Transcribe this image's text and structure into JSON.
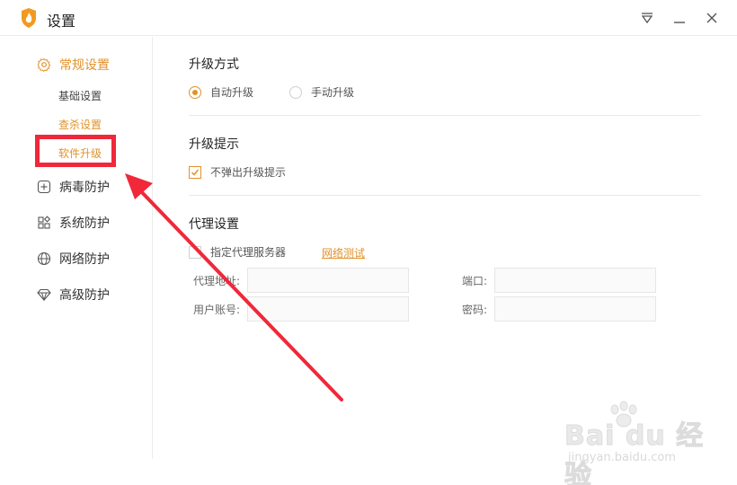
{
  "window": {
    "title": "设置",
    "controls": [
      "dropdown-icon",
      "minimize-icon",
      "close-icon"
    ]
  },
  "sidebar": {
    "groups": [
      {
        "label": "常规设置",
        "icon": "gear-icon",
        "active": true
      },
      {
        "label": "病毒防护",
        "icon": "plus-box-icon"
      },
      {
        "label": "系统防护",
        "icon": "grid-icon"
      },
      {
        "label": "网络防护",
        "icon": "globe-icon"
      },
      {
        "label": "高级防护",
        "icon": "diamond-icon"
      }
    ],
    "subitems": [
      {
        "label": "基础设置"
      },
      {
        "label": "查杀设置"
      },
      {
        "label": "软件升级",
        "active": true
      }
    ]
  },
  "main": {
    "upgrade_mode": {
      "title": "升级方式",
      "options": [
        {
          "label": "自动升级",
          "checked": true
        },
        {
          "label": "手动升级",
          "checked": false
        }
      ]
    },
    "upgrade_tip": {
      "title": "升级提示",
      "checkbox_label": "不弹出升级提示",
      "checked": true
    },
    "proxy": {
      "title": "代理设置",
      "checkbox_label": "指定代理服务器",
      "checked": false,
      "test_link": "网络测试",
      "address_label": "代理地址:",
      "address_value": "",
      "port_label": "端口:",
      "port_value": "",
      "account_label": "用户账号:",
      "account_value": "",
      "password_label": "密码:",
      "password_value": ""
    }
  },
  "watermark": {
    "main": "Bai du 经验",
    "sub": "jingyan.baidu.com"
  },
  "colors": {
    "accent": "#e0922b",
    "annotation": "#f0283a"
  }
}
